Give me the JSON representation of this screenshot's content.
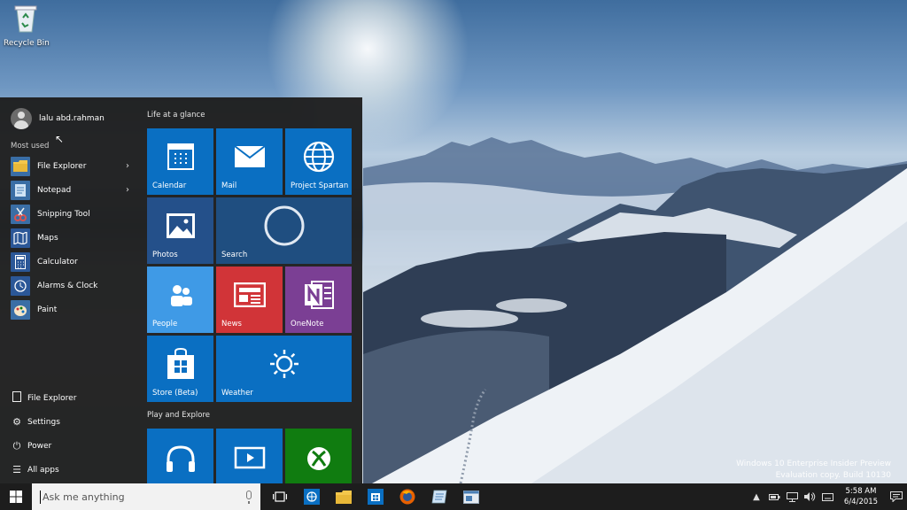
{
  "desktop": {
    "recycle_bin_label": "Recycle Bin",
    "watermark_line1": "Windows 10 Enterprise Insider Preview",
    "watermark_line2": "Evaluation copy. Build 10130"
  },
  "start_menu": {
    "user_name": "lalu abd.rahman",
    "most_used_label": "Most used",
    "most_used": [
      {
        "label": "File Explorer",
        "icon": "folder-icon",
        "color": "#e8b838",
        "has_arrow": true
      },
      {
        "label": "Notepad",
        "icon": "notepad-icon",
        "color": "#4a7fb5",
        "has_arrow": true
      },
      {
        "label": "Snipping Tool",
        "icon": "scissors-icon",
        "color": "#c0392b",
        "has_arrow": false
      },
      {
        "label": "Maps",
        "icon": "map-icon",
        "color": "#2b5797",
        "has_arrow": false
      },
      {
        "label": "Calculator",
        "icon": "calculator-icon",
        "color": "#2b5797",
        "has_arrow": false
      },
      {
        "label": "Alarms & Clock",
        "icon": "clock-icon",
        "color": "#2b5797",
        "has_arrow": false
      },
      {
        "label": "Paint",
        "icon": "palette-icon",
        "color": "#3a6ea5",
        "has_arrow": false
      }
    ],
    "bottom": [
      {
        "label": "File Explorer",
        "icon": "file-explorer-icon"
      },
      {
        "label": "Settings",
        "icon": "gear-icon"
      },
      {
        "label": "Power",
        "icon": "power-icon"
      },
      {
        "label": "All apps",
        "icon": "list-icon"
      }
    ],
    "group1_title": "Life at a glance",
    "group2_title": "Play and Explore",
    "tiles": {
      "calendar": {
        "label": "Calendar",
        "color": "#0a6fc2"
      },
      "mail": {
        "label": "Mail",
        "color": "#0a6fc2"
      },
      "spartan": {
        "label": "Project Spartan",
        "color": "#0a6fc2"
      },
      "photos": {
        "label": "Photos",
        "color": "#24508a"
      },
      "search": {
        "label": "Search",
        "color": "#1f4e80"
      },
      "people": {
        "label": "People",
        "color": "#3f9ae6"
      },
      "news": {
        "label": "News",
        "color": "#d13438"
      },
      "onenote": {
        "label": "OneNote",
        "color": "#7b3f94"
      },
      "store": {
        "label": "Store (Beta)",
        "color": "#0a6fc2"
      },
      "weather": {
        "label": "Weather",
        "color": "#0a6fc2"
      },
      "music": {
        "label": "",
        "color": "#0a6fc2"
      },
      "video": {
        "label": "",
        "color": "#0a6fc2"
      },
      "xbox": {
        "label": "",
        "color": "#107c10"
      }
    }
  },
  "taskbar": {
    "search_placeholder": "Ask me anything",
    "time": "5:58 AM",
    "date": "6/4/2015",
    "pinned": [
      "task-view-icon",
      "spartan-browser-icon",
      "file-explorer-icon",
      "store-icon",
      "firefox-icon",
      "notepad-icon",
      "window-app-icon"
    ]
  }
}
